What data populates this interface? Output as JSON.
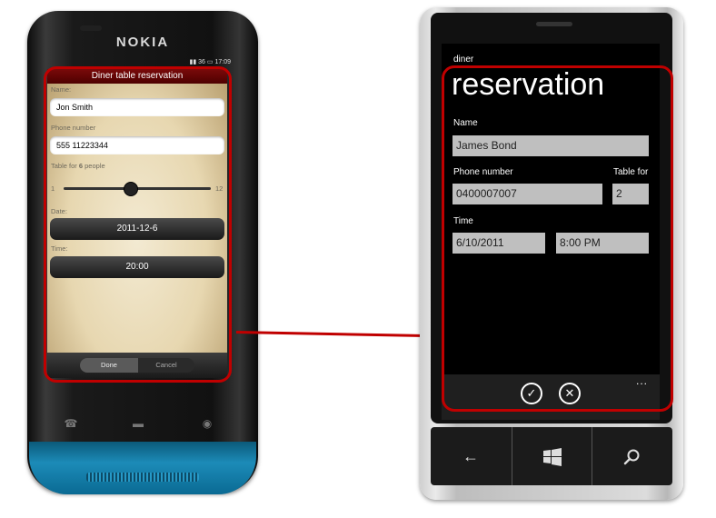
{
  "nokia": {
    "brand": "NOKIA",
    "status_time": "17:09",
    "status_signal": "36",
    "title": "Diner table reservation",
    "name_label": "Name:",
    "name_value": "Jon Smith",
    "phone_label": "Phone number",
    "phone_value": "555 11223344",
    "table_label_prefix": "Table for",
    "table_count": "6",
    "table_label_suffix": "people",
    "slider_min": "1",
    "slider_max": "12",
    "slider_value": 6,
    "date_label": "Date:",
    "date_value": "2011-12-6",
    "time_label": "Time:",
    "time_value": "20:00",
    "done_label": "Done",
    "cancel_label": "Cancel"
  },
  "wp": {
    "app_name": "diner",
    "page_title": "reservation",
    "name_label": "Name",
    "name_value": "James Bond",
    "phone_label": "Phone number",
    "phone_value": "0400007007",
    "table_label": "Table for",
    "table_value": "2",
    "time_label": "Time",
    "date_value": "6/10/2011",
    "time_value": "8:00 PM",
    "more_label": "...",
    "icons": {
      "accept": "check-icon",
      "cancel": "close-icon",
      "back": "back-arrow-icon",
      "start": "windows-logo-icon",
      "search": "search-icon"
    }
  },
  "colors": {
    "highlight": "#c00000",
    "nokia_title_bar": "#6b0505",
    "nokia_accent_blue": "#1c8bb8"
  }
}
